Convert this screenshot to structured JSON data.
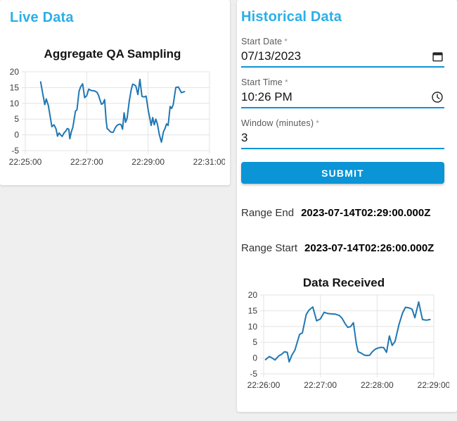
{
  "colors": {
    "accent": "#2aafe8",
    "primary": "#0b94d6",
    "page_bg": "#efefef",
    "line": "#1f77b4",
    "grid": "#e3e3e3"
  },
  "live_panel": {
    "title": "Live Data"
  },
  "historical_panel": {
    "title": "Historical Data",
    "fields": [
      {
        "label": "Start Date",
        "required": "*",
        "value": "07/13/2023",
        "icon": "calendar-icon"
      },
      {
        "label": "Start Time",
        "required": "*",
        "value": "10:26 PM",
        "icon": "clock-icon"
      },
      {
        "label": "Window (minutes)",
        "required": "*",
        "value": "3",
        "icon": ""
      }
    ],
    "submit_label": "SUBMIT",
    "results": [
      {
        "label": "Range End",
        "value": "2023-07-14T02:29:00.000Z"
      },
      {
        "label": "Range Start",
        "value": "2023-07-14T02:26:00.000Z"
      }
    ]
  },
  "chart_data": [
    {
      "type": "line",
      "title": "Aggregate QA Sampling",
      "xlabel": "",
      "ylabel": "",
      "x_ticks": [
        "22:25:00",
        "22:27:00",
        "22:29:00",
        "22:31:00"
      ],
      "x_tick_seconds": [
        0,
        120,
        240,
        360
      ],
      "x_range_seconds": [
        0,
        360
      ],
      "y_ticks": [
        20,
        15,
        10,
        5,
        0,
        -5
      ],
      "ylim": [
        -5,
        20
      ],
      "grid": true,
      "legend": "none",
      "line_color": "#1f77b4",
      "points": [
        [
          30,
          16.8
        ],
        [
          34,
          13.2
        ],
        [
          38,
          9.6
        ],
        [
          41,
          11.4
        ],
        [
          45,
          9.3
        ],
        [
          52,
          2.6
        ],
        [
          56,
          3.2
        ],
        [
          60,
          1.9
        ],
        [
          63,
          -0.4
        ],
        [
          66,
          0.6
        ],
        [
          69,
          0.0
        ],
        [
          72,
          -0.5
        ],
        [
          76,
          0.7
        ],
        [
          79,
          1.2
        ],
        [
          82,
          2.0
        ],
        [
          85,
          1.8
        ],
        [
          87,
          -1.2
        ],
        [
          90,
          1.0
        ],
        [
          93,
          2.5
        ],
        [
          98,
          7.5
        ],
        [
          101,
          8.0
        ],
        [
          105,
          13.8
        ],
        [
          108,
          15.2
        ],
        [
          112,
          16.2
        ],
        [
          116,
          11.8
        ],
        [
          120,
          12.4
        ],
        [
          124,
          14.5
        ],
        [
          128,
          14.1
        ],
        [
          132,
          14.0
        ],
        [
          136,
          13.9
        ],
        [
          140,
          13.5
        ],
        [
          143,
          12.6
        ],
        [
          146,
          11.0
        ],
        [
          149,
          9.7
        ],
        [
          152,
          10.0
        ],
        [
          155,
          11.2
        ],
        [
          158,
          4.5
        ],
        [
          160,
          2.0
        ],
        [
          163,
          1.6
        ],
        [
          166,
          1.0
        ],
        [
          169,
          0.8
        ],
        [
          172,
          0.9
        ],
        [
          175,
          2.0
        ],
        [
          178,
          2.8
        ],
        [
          181,
          3.2
        ],
        [
          184,
          3.4
        ],
        [
          187,
          3.3
        ],
        [
          190,
          1.8
        ],
        [
          193,
          7.0
        ],
        [
          196,
          4.0
        ],
        [
          199,
          5.3
        ],
        [
          203,
          10.5
        ],
        [
          207,
          14.3
        ],
        [
          210,
          16.1
        ],
        [
          213,
          15.9
        ],
        [
          216,
          15.5
        ],
        [
          220,
          12.8
        ],
        [
          224,
          17.6
        ],
        [
          228,
          12.2
        ],
        [
          232,
          12.0
        ],
        [
          236,
          12.3
        ],
        [
          240,
          8.0
        ],
        [
          243,
          5.5
        ],
        [
          246,
          3.0
        ],
        [
          249,
          5.5
        ],
        [
          252,
          3.2
        ],
        [
          255,
          5.0
        ],
        [
          258,
          3.5
        ],
        [
          262,
          0.0
        ],
        [
          266,
          -2.3
        ],
        [
          270,
          1.0
        ],
        [
          273,
          2.0
        ],
        [
          276,
          3.5
        ],
        [
          279,
          3.0
        ],
        [
          283,
          9.0
        ],
        [
          286,
          8.4
        ],
        [
          289,
          9.5
        ],
        [
          294,
          15.0
        ],
        [
          299,
          15.2
        ],
        [
          305,
          13.4
        ],
        [
          311,
          13.7
        ]
      ]
    },
    {
      "type": "line",
      "title": "Data Received",
      "xlabel": "",
      "ylabel": "",
      "x_ticks": [
        "22:26:00",
        "22:27:00",
        "22:28:00",
        "22:29:00"
      ],
      "x_tick_seconds": [
        0,
        60,
        120,
        180
      ],
      "x_range_seconds": [
        0,
        180
      ],
      "y_ticks": [
        20,
        15,
        10,
        5,
        0,
        -5
      ],
      "ylim": [
        -5,
        20
      ],
      "grid": true,
      "legend": "none",
      "line_color": "#1f77b4",
      "points": [
        [
          2,
          -0.5
        ],
        [
          6,
          0.5
        ],
        [
          9,
          0.0
        ],
        [
          12,
          -0.6
        ],
        [
          16,
          0.7
        ],
        [
          19,
          1.2
        ],
        [
          22,
          2.0
        ],
        [
          25,
          1.8
        ],
        [
          27,
          -1.2
        ],
        [
          30,
          1.0
        ],
        [
          33,
          2.5
        ],
        [
          38,
          7.5
        ],
        [
          41,
          8.0
        ],
        [
          45,
          13.8
        ],
        [
          48,
          15.2
        ],
        [
          52,
          16.2
        ],
        [
          56,
          11.8
        ],
        [
          60,
          12.4
        ],
        [
          64,
          14.5
        ],
        [
          68,
          14.1
        ],
        [
          72,
          14.0
        ],
        [
          76,
          13.9
        ],
        [
          80,
          13.5
        ],
        [
          83,
          12.6
        ],
        [
          86,
          11.0
        ],
        [
          89,
          9.7
        ],
        [
          92,
          10.0
        ],
        [
          95,
          11.2
        ],
        [
          98,
          4.5
        ],
        [
          100,
          2.0
        ],
        [
          103,
          1.6
        ],
        [
          106,
          1.0
        ],
        [
          109,
          0.8
        ],
        [
          112,
          0.9
        ],
        [
          115,
          2.0
        ],
        [
          118,
          2.8
        ],
        [
          121,
          3.2
        ],
        [
          124,
          3.4
        ],
        [
          127,
          3.3
        ],
        [
          130,
          1.8
        ],
        [
          133,
          7.0
        ],
        [
          136,
          4.0
        ],
        [
          139,
          5.3
        ],
        [
          143,
          10.5
        ],
        [
          147,
          14.3
        ],
        [
          150,
          16.1
        ],
        [
          154,
          15.9
        ],
        [
          157,
          15.5
        ],
        [
          160,
          12.8
        ],
        [
          164,
          17.8
        ],
        [
          168,
          12.2
        ],
        [
          172,
          12.0
        ],
        [
          176,
          12.2
        ]
      ]
    }
  ]
}
